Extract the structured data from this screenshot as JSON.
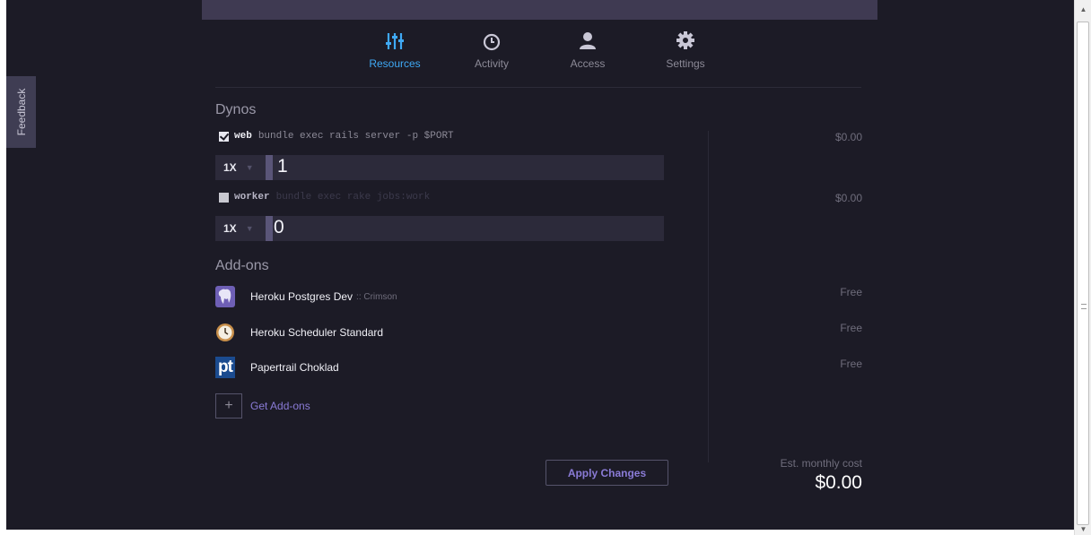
{
  "tabs": [
    {
      "label": "Resources",
      "icon": "sliders-icon",
      "active": true
    },
    {
      "label": "Activity",
      "icon": "clock-icon",
      "active": false
    },
    {
      "label": "Access",
      "icon": "user-icon",
      "active": false
    },
    {
      "label": "Settings",
      "icon": "gear-icon",
      "active": false
    }
  ],
  "feedback_label": "Feedback",
  "dynos": {
    "title": "Dynos",
    "processes": [
      {
        "name": "web",
        "command": "bundle exec rails server -p $PORT",
        "enabled": true,
        "size": "1X",
        "quantity": "1",
        "price": "$0.00"
      },
      {
        "name": "worker",
        "command": "bundle exec rake jobs:work",
        "enabled": false,
        "size": "1X",
        "quantity": "0",
        "price": "$0.00"
      }
    ]
  },
  "addons": {
    "title": "Add-ons",
    "items": [
      {
        "name": "Heroku Postgres Dev",
        "plan": ":: Crimson",
        "price": "Free",
        "icon": "postgres-elephant-icon"
      },
      {
        "name": "Heroku Scheduler Standard",
        "plan": "",
        "price": "Free",
        "icon": "scheduler-clock-icon"
      },
      {
        "name": "Papertrail Choklad",
        "plan": "",
        "price": "Free",
        "icon": "papertrail-pt-icon"
      }
    ],
    "get_label": "Get Add-ons",
    "get_plus": "+"
  },
  "apply_label": "Apply Changes",
  "estimate": {
    "label": "Est. monthly cost",
    "total": "$0.00"
  },
  "papertrail_logo_text": "pt",
  "colors": {
    "accent": "#3fa9f5",
    "link": "#8a7bd6",
    "background": "#1c1b26",
    "header": "#3f3a52"
  }
}
